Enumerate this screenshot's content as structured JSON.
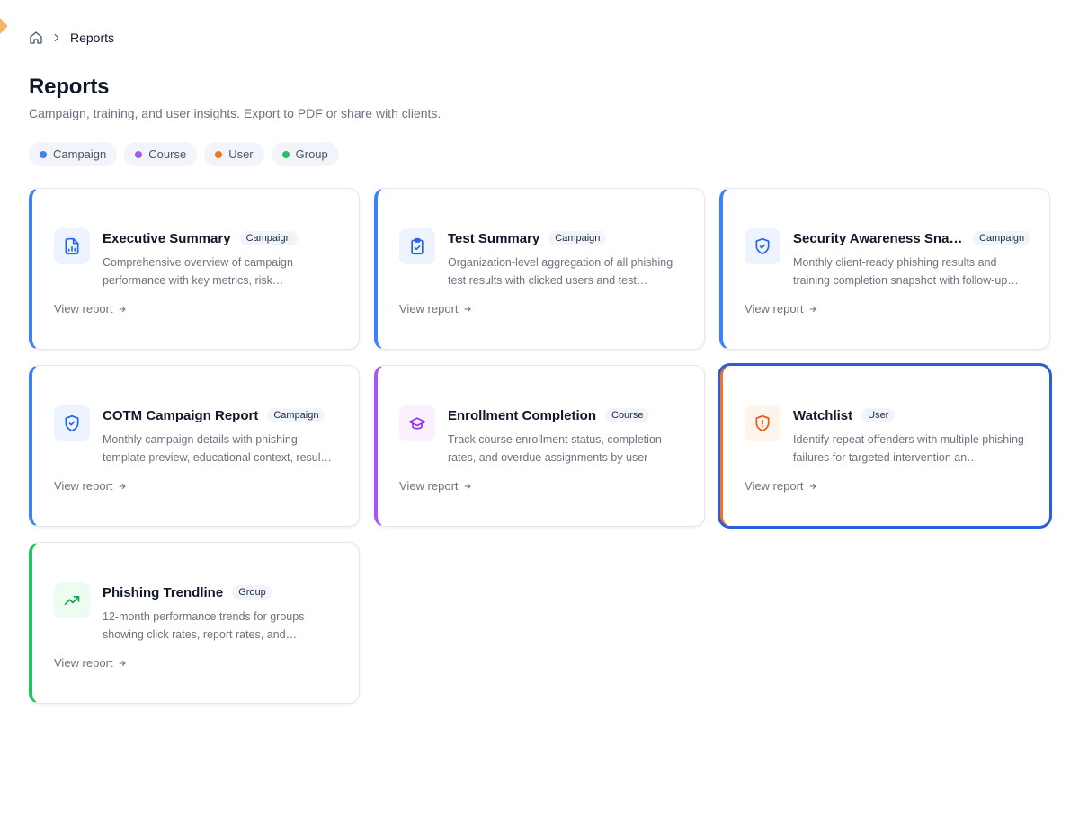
{
  "breadcrumb": {
    "home_icon": "home-icon",
    "separator_icon": "chevron-right-icon",
    "current": "Reports"
  },
  "header": {
    "title": "Reports",
    "subtitle": "Campaign, training, and user insights. Export to PDF or share with clients."
  },
  "filters": [
    {
      "label": "Campaign",
      "color": "#3b82f6"
    },
    {
      "label": "Course",
      "color": "#a855f7"
    },
    {
      "label": "User",
      "color": "#f97316"
    },
    {
      "label": "Group",
      "color": "#22c55e"
    }
  ],
  "colors": {
    "campaign": "#3b82f6",
    "course": "#a855f7",
    "user": "#f97316",
    "group": "#22c55e",
    "selected_outline": "#2b5fd9"
  },
  "cards": [
    {
      "title": "Executive Summary",
      "badge": "Campaign",
      "description": "Comprehensive overview of campaign performance with key metrics, risk…",
      "link": "View report",
      "icon": "file-chart-icon"
    },
    {
      "title": "Test Summary",
      "badge": "Campaign",
      "description": "Organization-level aggregation of all phishing test results with clicked users and test…",
      "link": "View report",
      "icon": "clipboard-check-icon"
    },
    {
      "title": "Security Awareness Snap…",
      "badge": "Campaign",
      "description": "Monthly client-ready phishing results and training completion snapshot with follow-up…",
      "link": "View report",
      "icon": "shield-check-icon"
    },
    {
      "title": "COTM Campaign Report",
      "badge": "Campaign",
      "description": "Monthly campaign details with phishing template preview, educational context, resul…",
      "link": "View report",
      "icon": "shield-check-icon"
    },
    {
      "title": "Enrollment Completion",
      "badge": "Course",
      "description": "Track course enrollment status, completion rates, and overdue assignments by user",
      "link": "View report",
      "icon": "graduation-cap-icon"
    },
    {
      "title": "Watchlist",
      "badge": "User",
      "description": "Identify repeat offenders with multiple phishing failures for targeted intervention an…",
      "link": "View report",
      "icon": "shield-alert-icon"
    },
    {
      "title": "Phishing Trendline",
      "badge": "Group",
      "description": "12-month performance trends for groups showing click rates, report rates, and…",
      "link": "View report",
      "icon": "trending-up-icon"
    }
  ]
}
